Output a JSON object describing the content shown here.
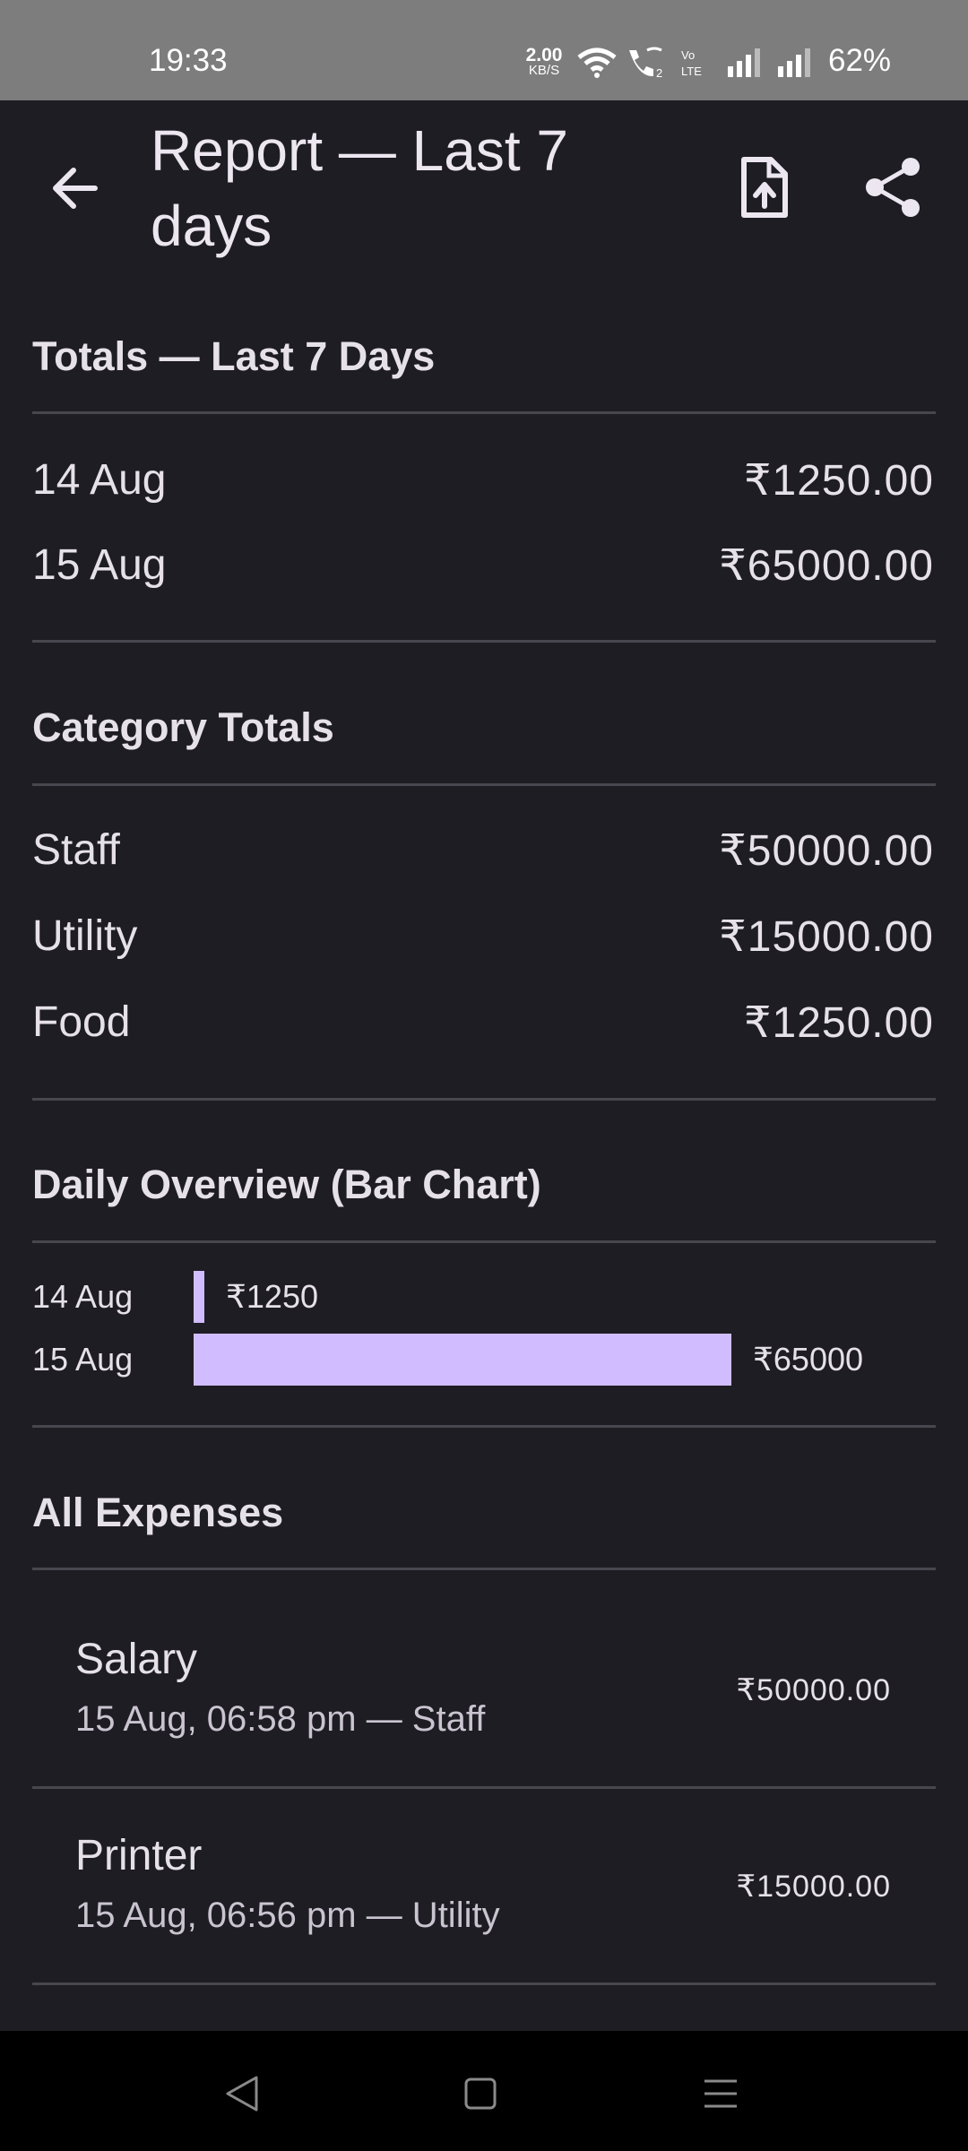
{
  "status_bar": {
    "time": "19:33",
    "net_speed_value": "2.00",
    "net_speed_unit": "KB/S",
    "battery": "62%",
    "icons": [
      "wifi-icon",
      "wifi-call-icon",
      "volte-icon",
      "signal-icon",
      "signal-icon"
    ]
  },
  "app_bar": {
    "title": "Report — Last 7 days",
    "back_icon": "arrow-left-icon",
    "export_icon": "file-upload-icon",
    "share_icon": "share-icon"
  },
  "totals": {
    "title": "Totals — Last 7 Days",
    "rows": [
      {
        "label": "14 Aug",
        "value": "₹1250.00"
      },
      {
        "label": "15 Aug",
        "value": "₹65000.00"
      }
    ]
  },
  "categories": {
    "title": "Category Totals",
    "rows": [
      {
        "label": "Staff",
        "value": "₹50000.00"
      },
      {
        "label": "Utility",
        "value": "₹15000.00"
      },
      {
        "label": "Food",
        "value": "₹1250.00"
      }
    ]
  },
  "daily_overview": {
    "title": "Daily Overview (Bar Chart)"
  },
  "chart_data": {
    "type": "bar",
    "orientation": "horizontal",
    "title": "Daily Overview (Bar Chart)",
    "categories": [
      "14 Aug",
      "15 Aug"
    ],
    "values": [
      1250,
      65000
    ],
    "value_labels": [
      "₹1250",
      "₹65000"
    ],
    "bar_color": "#d0bcff"
  },
  "expenses": {
    "title": "All Expenses",
    "items": [
      {
        "title": "Salary",
        "subtitle": "15 Aug, 06:58 pm — Staff",
        "amount": "₹50000.00"
      },
      {
        "title": "Printer",
        "subtitle": "15 Aug, 06:56 pm — Utility",
        "amount": "₹15000.00"
      }
    ]
  },
  "nav_bar": {
    "icons": [
      "back-triangle-icon",
      "home-square-icon",
      "menu-lines-icon"
    ]
  },
  "colors": {
    "background": "#1e1d23",
    "accent": "#d0bcff",
    "divider": "#48464e"
  }
}
